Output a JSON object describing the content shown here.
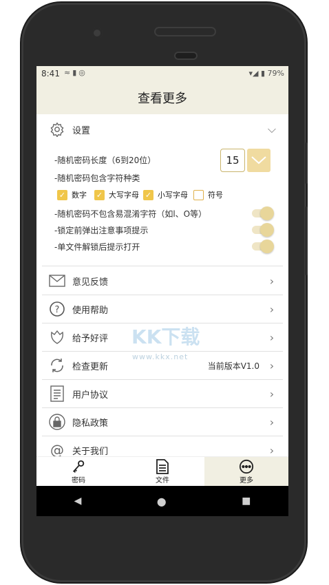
{
  "status": {
    "time": "8:41",
    "battery": "79%"
  },
  "header": {
    "title": "查看更多"
  },
  "settings": {
    "label": "设置",
    "length_label": "-随机密码长度（6到20位）",
    "length_value": "15",
    "types_label": "-随机密码包含字符种类",
    "checkboxes": [
      {
        "label": "数字",
        "checked": true
      },
      {
        "label": "大写字母",
        "checked": true
      },
      {
        "label": "小写字母",
        "checked": true
      },
      {
        "label": "符号",
        "checked": false
      }
    ],
    "toggles": [
      {
        "label": "-随机密码不包含易混淆字符（如l、O等）",
        "on": true
      },
      {
        "label": "-锁定前弹出注意事项提示",
        "on": true
      },
      {
        "label": "-单文件解锁后提示打开",
        "on": true
      }
    ]
  },
  "menu": [
    {
      "label": "意见反馈",
      "icon": "mail-icon",
      "value": ""
    },
    {
      "label": "使用帮助",
      "icon": "help-icon",
      "value": ""
    },
    {
      "label": "给予好评",
      "icon": "flower-icon",
      "value": ""
    },
    {
      "label": "检查更新",
      "icon": "refresh-icon",
      "value": "当前版本V1.0"
    },
    {
      "label": "用户协议",
      "icon": "document-icon",
      "value": ""
    },
    {
      "label": "隐私政策",
      "icon": "lock-icon",
      "value": ""
    },
    {
      "label": "关于我们",
      "icon": "at-icon",
      "value": ""
    }
  ],
  "watermark": {
    "title": "KK下载",
    "url": "www.kkx.net"
  },
  "bottom_nav": [
    {
      "label": "密码",
      "icon": "key-icon"
    },
    {
      "label": "文件",
      "icon": "file-icon"
    },
    {
      "label": "更多",
      "icon": "more-icon",
      "active": true
    }
  ],
  "colors": {
    "accent": "#f0c64a",
    "header_bg": "#f1efe2",
    "toggle": "#e8d69a"
  }
}
